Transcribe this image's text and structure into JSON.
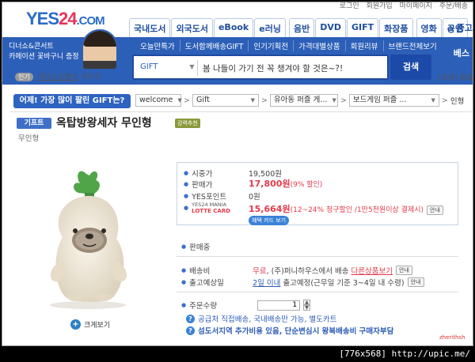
{
  "header": {
    "logo_main": "YES",
    "logo_num": "24",
    "logo_suffix": ".COM",
    "toplinks": [
      "로그인",
      "회원가입",
      "마이페이지",
      "주문/배송"
    ],
    "tabs": [
      "국내도서",
      "외국도서",
      "eBook",
      "e러닝",
      "음반",
      "DVD",
      "GIFT",
      "화장품",
      "영화",
      "공연"
    ],
    "center_corner": "중고"
  },
  "promo": {
    "line1": "디너쇼&콘서트",
    "line2": "카메이션 꽃바구니 증정"
  },
  "subnav": [
    "오늘만특가",
    "도서함께배송GIFT",
    "인기기획전",
    "가격대별상품",
    "회원리뷰",
    "브랜드전체보기"
  ],
  "best_label": "베스",
  "search": {
    "category": "GIFT",
    "query": "봄 나들이 가기 전 꼭 챙겨야 할 것은~?!",
    "button": "검색",
    "right_links": "[초대] 유효"
  },
  "hot": {
    "badge": "인기",
    "link": "마더스교양이",
    "rest": ", 위키드"
  },
  "best_question": "어제! 가장 많이 팔린 GIFT는?",
  "breadcrumb": {
    "c1": "welcome",
    "c2": "Gift",
    "c3": "유아동 퍼즐 게...",
    "c4": "보드게임 퍼즐 ...",
    "last": "인형"
  },
  "product": {
    "tag": "기프트",
    "title": "옥탑방왕세자 무인형",
    "rec_badge": "강력추천",
    "subtitle": "무인형",
    "zoom_label": "크게보기"
  },
  "price": {
    "list_label": "시중가",
    "list_value": "19,500원",
    "sale_label": "판매가",
    "sale_value": "17,800원",
    "sale_discount": "(9% 할인)",
    "point_label": "YES포인트",
    "point_value": "0원",
    "mania_line1": "YES24 MANIA",
    "mania_line2": "LOTTE CARD",
    "mania_value": "15,664원",
    "mania_desc": "(12~24% 청구할인 /1만5천원이상 결제시)",
    "info_btn": "안내",
    "benefit_btn": "혜택 카드 보기"
  },
  "status": {
    "label": "판매중"
  },
  "shipping": {
    "fee_label": "배송비",
    "fee_free": "무료",
    "fee_text": ", (주)퍼니하우스에서 배송",
    "fee_link": "다른상품보기",
    "fee_info": "안내",
    "date_label": "출고예상일",
    "date_value": "2일 이내",
    "date_text": "출고예정(근무일 기준 3~4일 내 수령)",
    "date_info": "안내"
  },
  "order": {
    "qty_label": "주문수량",
    "qty_value": "1",
    "notice1": "공급처 직접배송, 국내배송만 가능, 별도카트",
    "notice2": "섬도서지역 추가비용 있음, 단순변심시 왕복배송비 구매자부담"
  },
  "watermark": "zherithsh",
  "caption": "[776x568] http://upic.me/"
}
